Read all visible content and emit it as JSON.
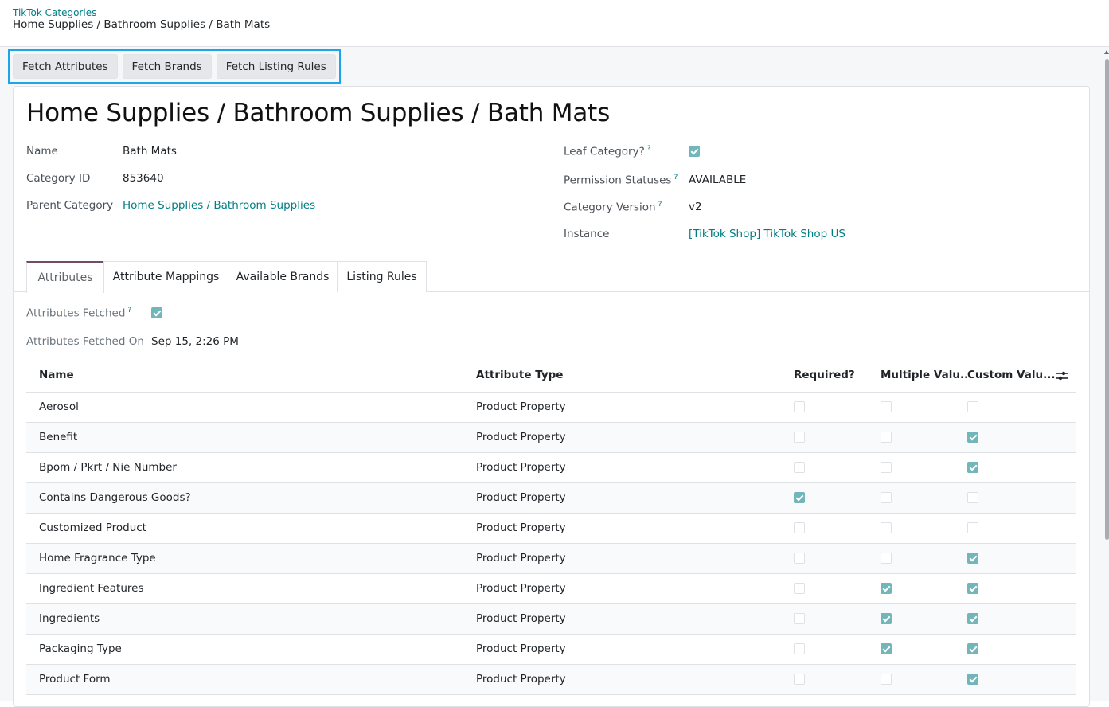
{
  "breadcrumb": {
    "parent": "TikTok Categories",
    "current": "Home Supplies / Bathroom Supplies / Bath Mats"
  },
  "action_buttons": [
    "Fetch Attributes",
    "Fetch Brands",
    "Fetch Listing Rules"
  ],
  "record": {
    "title": "Home Supplies / Bathroom Supplies / Bath Mats",
    "fields_left": {
      "name_label": "Name",
      "name_value": "Bath Mats",
      "category_id_label": "Category ID",
      "category_id_value": "853640",
      "parent_label": "Parent Category",
      "parent_value": "Home Supplies / Bathroom Supplies"
    },
    "fields_right": {
      "leaf_label": "Leaf Category?",
      "leaf_checked": true,
      "permission_label": "Permission Statuses",
      "permission_value": "AVAILABLE",
      "version_label": "Category Version",
      "version_value": "v2",
      "instance_label": "Instance",
      "instance_value": "[TikTok Shop] TikTok Shop US"
    },
    "help_mark": "?"
  },
  "tabs": [
    "Attributes",
    "Attribute Mappings",
    "Available Brands",
    "Listing Rules"
  ],
  "active_tab": "Attributes",
  "attributes_tab": {
    "fetched_label": "Attributes Fetched",
    "fetched_checked": true,
    "fetched_on_label": "Attributes Fetched On",
    "fetched_on_value": "Sep 15, 2:26 PM",
    "columns": [
      "Name",
      "Attribute Type",
      "Required?",
      "Multiple Valu...",
      "Custom Valu..."
    ],
    "rows": [
      {
        "name": "Aerosol",
        "type": "Product Property",
        "required": false,
        "multiple": false,
        "custom": false
      },
      {
        "name": "Benefit",
        "type": "Product Property",
        "required": false,
        "multiple": false,
        "custom": true
      },
      {
        "name": "Bpom / Pkrt / Nie Number",
        "type": "Product Property",
        "required": false,
        "multiple": false,
        "custom": true
      },
      {
        "name": "Contains Dangerous Goods?",
        "type": "Product Property",
        "required": true,
        "multiple": false,
        "custom": false
      },
      {
        "name": "Customized Product",
        "type": "Product Property",
        "required": false,
        "multiple": false,
        "custom": false
      },
      {
        "name": "Home Fragrance Type",
        "type": "Product Property",
        "required": false,
        "multiple": false,
        "custom": true
      },
      {
        "name": "Ingredient Features",
        "type": "Product Property",
        "required": false,
        "multiple": true,
        "custom": true
      },
      {
        "name": "Ingredients",
        "type": "Product Property",
        "required": false,
        "multiple": true,
        "custom": true
      },
      {
        "name": "Packaging Type",
        "type": "Product Property",
        "required": false,
        "multiple": true,
        "custom": true
      },
      {
        "name": "Product Form",
        "type": "Product Property",
        "required": false,
        "multiple": false,
        "custom": true
      }
    ]
  }
}
